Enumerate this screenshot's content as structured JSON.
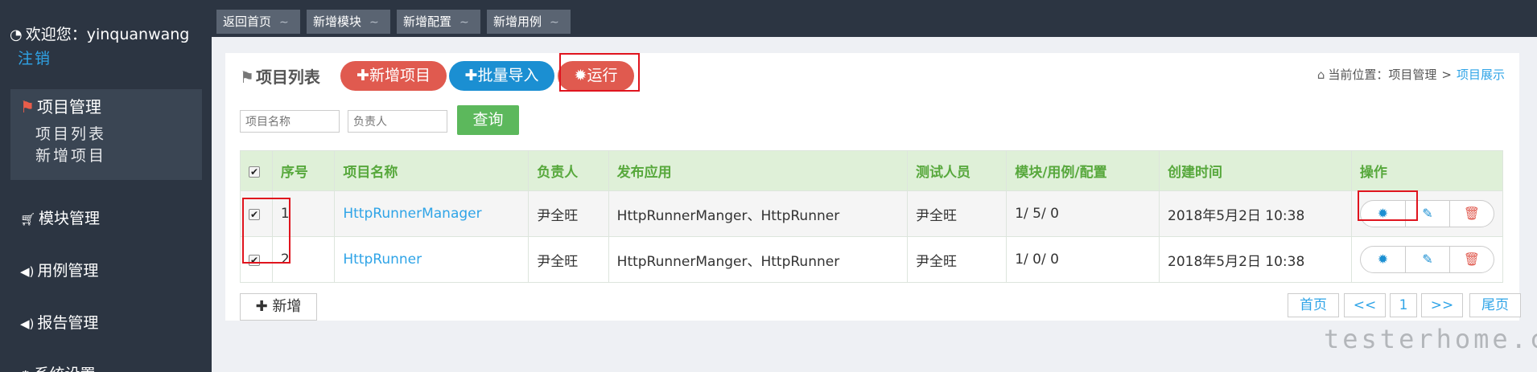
{
  "sidebar": {
    "welcome": "欢迎您：yinquanwang",
    "logout": "注销",
    "project_menu": {
      "label": "项目管理",
      "items": [
        "项目列表",
        "新增项目"
      ]
    },
    "items": [
      {
        "label": "模块管理",
        "icon": "cart-icon"
      },
      {
        "label": "用例管理",
        "icon": "volume-icon"
      },
      {
        "label": "报告管理",
        "icon": "volume-icon"
      },
      {
        "label": "系统设置",
        "icon": "gears-icon"
      }
    ]
  },
  "tabs": [
    {
      "label": "返回首页"
    },
    {
      "label": "新增模块"
    },
    {
      "label": "新增配置"
    },
    {
      "label": "新增用例"
    }
  ],
  "panel": {
    "title": "项目列表",
    "buttons": {
      "add_project": "✚新增项目",
      "batch_import": "✚批量导入",
      "run": "运行"
    },
    "breadcrumb": {
      "prefix": "当前位置：",
      "parent": "项目管理",
      "separator": ">",
      "current": "项目展示"
    },
    "filters": {
      "project_name_placeholder": "项目名称",
      "owner_placeholder": "负责人",
      "query_label": "查询"
    }
  },
  "table": {
    "headers": [
      "序号",
      "项目名称",
      "负责人",
      "发布应用",
      "测试人员",
      "模块/用例/配置",
      "创建时间",
      "操作"
    ],
    "rows": [
      {
        "index": "1",
        "name": "HttpRunnerManager",
        "owner": "尹全旺",
        "apps": "HttpRunnerManger、HttpRunner",
        "testers": "尹全旺",
        "counts": "1/ 5/ 0",
        "created": "2018年5月2日 10:38",
        "checked": true
      },
      {
        "index": "2",
        "name": "HttpRunner",
        "owner": "尹全旺",
        "apps": "HttpRunnerManger、HttpRunner",
        "testers": "尹全旺",
        "counts": "1/ 0/ 0",
        "created": "2018年5月2日 10:38",
        "checked": true
      }
    ]
  },
  "footer": {
    "add_label": "新增",
    "pager": {
      "first": "首页",
      "prev": "<<",
      "page": "1",
      "next": ">>",
      "last": "尾页"
    }
  },
  "watermark": "testerhome.com",
  "colors": {
    "sidebar_bg": "#2c3542",
    "accent_red": "#e05a4f",
    "accent_blue": "#1b8fd2",
    "link_blue": "#2fa4e7",
    "query_green": "#5cb85c",
    "header_green_bg": "#dff0d8",
    "highlight_red": "#e0141e"
  }
}
